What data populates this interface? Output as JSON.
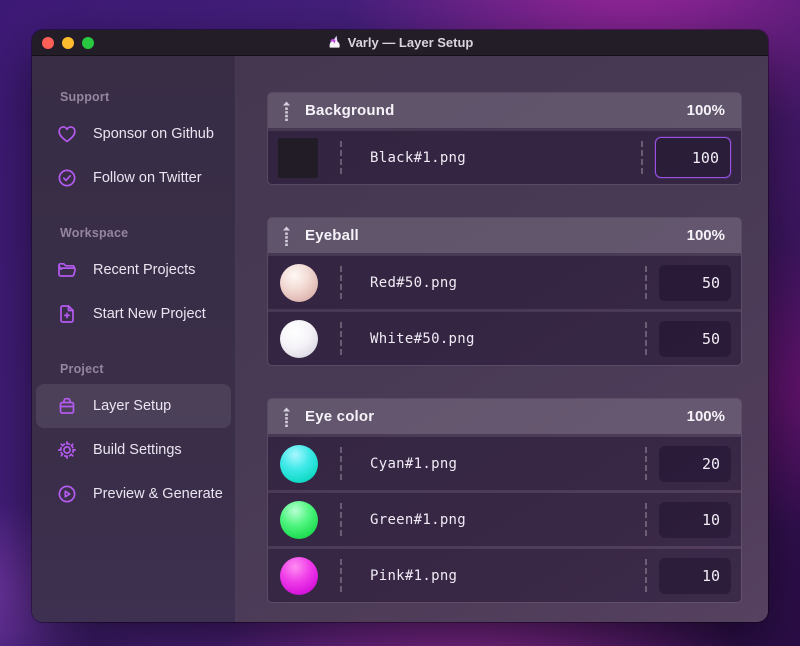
{
  "window": {
    "title": "Varly — Layer Setup"
  },
  "sidebar": {
    "sections": [
      {
        "label": "Support",
        "items": [
          {
            "label": "Sponsor on Github",
            "icon": "heart-icon"
          },
          {
            "label": "Follow on Twitter",
            "icon": "check-badge-icon"
          }
        ]
      },
      {
        "label": "Workspace",
        "items": [
          {
            "label": "Recent Projects",
            "icon": "folder-icon"
          },
          {
            "label": "Start New Project",
            "icon": "file-plus-icon"
          }
        ]
      },
      {
        "label": "Project",
        "items": [
          {
            "label": "Layer Setup",
            "icon": "layers-box-icon",
            "active": true
          },
          {
            "label": "Build Settings",
            "icon": "gear-icon"
          },
          {
            "label": "Preview & Generate",
            "icon": "play-circle-icon"
          }
        ]
      }
    ]
  },
  "groups": [
    {
      "name": "Background",
      "weight": "100%",
      "layers": [
        {
          "file": "Black#1.png",
          "value": "100",
          "thumb": "black-square",
          "focused": true
        }
      ]
    },
    {
      "name": "Eyeball",
      "weight": "100%",
      "layers": [
        {
          "file": "Red#50.png",
          "value": "50",
          "thumb": "red-sphere"
        },
        {
          "file": "White#50.png",
          "value": "50",
          "thumb": "white-sphere"
        }
      ]
    },
    {
      "name": "Eye color",
      "weight": "100%",
      "layers": [
        {
          "file": "Cyan#1.png",
          "value": "20",
          "thumb": "cyan-sphere"
        },
        {
          "file": "Green#1.png",
          "value": "10",
          "thumb": "green-sphere"
        },
        {
          "file": "Pink#1.png",
          "value": "10",
          "thumb": "pink-sphere"
        }
      ]
    }
  ],
  "colors": {
    "accent": "#b45af0",
    "focus_border": "#9b51e8",
    "titlebar_bg": "#231d27",
    "sidebar_bg": "#382d45",
    "main_bg": "#483a55",
    "row_bg": "#382b4c",
    "traffic_red": "#ff5f57",
    "traffic_yellow": "#febc2e",
    "traffic_green": "#28c840",
    "thumb_black": "#211c26",
    "thumb_cyan": "#12dac6",
    "thumb_green": "#20de53",
    "thumb_pink": "#d714dc"
  }
}
